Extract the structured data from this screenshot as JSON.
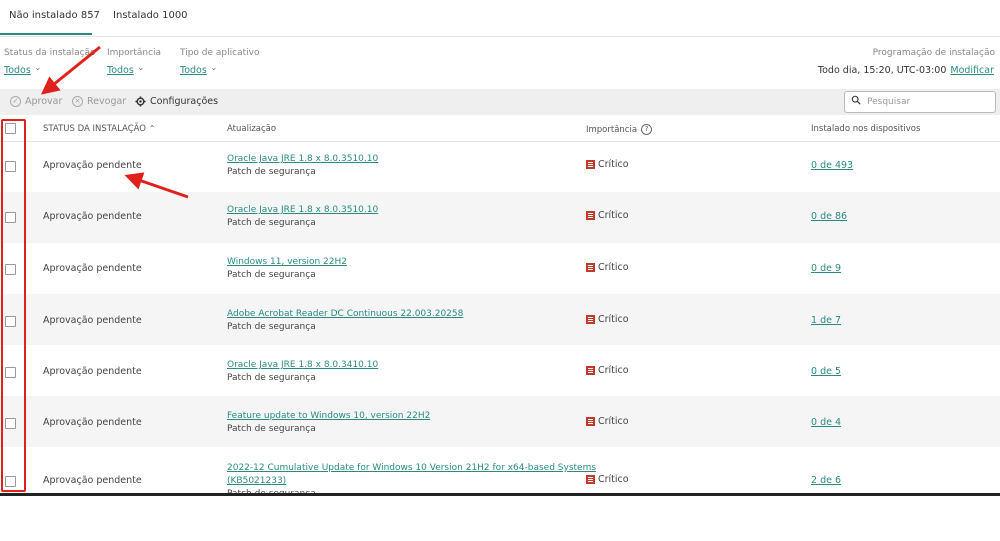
{
  "tabs": [
    {
      "label": "Não instalado 857",
      "active": true
    },
    {
      "label": "Instalado 1000",
      "active": false
    }
  ],
  "filters": [
    {
      "label": "Status da instalação",
      "value": "Todos"
    },
    {
      "label": "Importância",
      "value": "Todos"
    },
    {
      "label": "Tipo de aplicativo",
      "value": "Todos"
    }
  ],
  "schedule": {
    "label": "Programação de instalação",
    "value": "Todo dia, 15:20, UTC-03:00",
    "link": "Modificar"
  },
  "toolbar": {
    "approve": "Aprovar",
    "revoke": "Revogar",
    "settings": "Configurações",
    "search_placeholder": "Pesquisar"
  },
  "table": {
    "headers": {
      "status": "STATUS DA INSTALAÇÃO",
      "update": "Atualização",
      "importance": "Importância",
      "installed": "Instalado nos dispositivos"
    },
    "rows": [
      {
        "status": "Aprovação pendente",
        "update_line1": "Oracle Java JRE 1.8 x 8.0.3510.10",
        "update_line2": "",
        "type": "Patch de segurança",
        "importance": "Crítico",
        "installed": "0 de 493"
      },
      {
        "status": "Aprovação pendente",
        "update_line1": "Oracle Java JRE 1.8 x 8.0.3510.10",
        "update_line2": "",
        "type": "Patch de segurança",
        "importance": "Crítico",
        "installed": "0 de 86"
      },
      {
        "status": "Aprovação pendente",
        "update_line1": "Windows 11, version 22H2",
        "update_line2": "",
        "type": "Patch de segurança",
        "importance": "Crítico",
        "installed": "0 de 9"
      },
      {
        "status": "Aprovação pendente",
        "update_line1": "Adobe Acrobat Reader DC Continuous 22.003.20258",
        "update_line2": "",
        "type": "Patch de segurança",
        "importance": "Crítico",
        "installed": "1 de 7"
      },
      {
        "status": "Aprovação pendente",
        "update_line1": "Oracle Java JRE 1.8 x 8.0.3410.10",
        "update_line2": "",
        "type": "Patch de segurança",
        "importance": "Crítico",
        "installed": "0 de 5"
      },
      {
        "status": "Aprovação pendente",
        "update_line1": "Feature update to Windows 10, version 22H2",
        "update_line2": "",
        "type": "Patch de segurança",
        "importance": "Crítico",
        "installed": "0 de 4"
      },
      {
        "status": "Aprovação pendente",
        "update_line1": "2022-12 Cumulative Update for Windows 10 Version 21H2 for x64-based Systems",
        "update_line2": "(KB5021233)",
        "type": "Patch de segurança",
        "importance": "Crítico",
        "installed": "2 de 6"
      }
    ]
  },
  "colors": {
    "accent": "#2a8a83",
    "critical": "#c0392b",
    "annotation": "#e0211b"
  },
  "icons": {
    "approve": "check-circle-icon",
    "revoke": "x-circle-icon",
    "settings": "gear-icon",
    "search": "search-icon",
    "importance_help": "question-circle-icon",
    "critical": "critical-icon"
  }
}
